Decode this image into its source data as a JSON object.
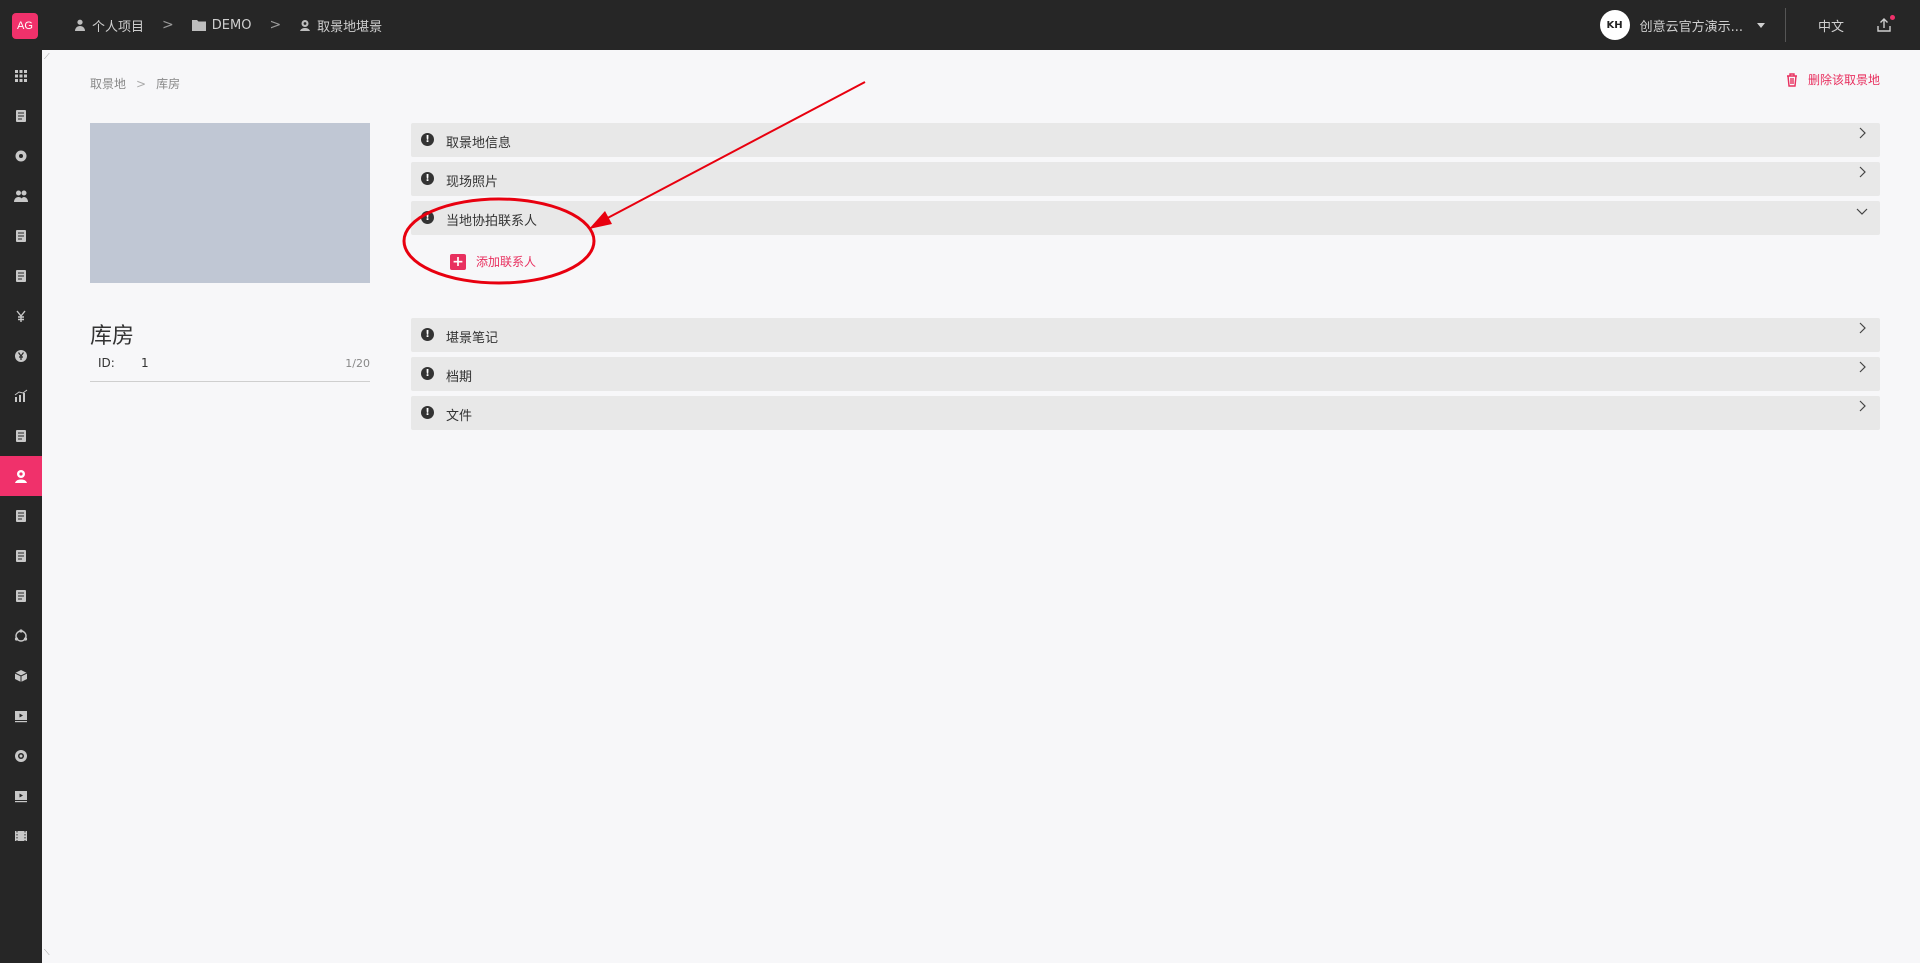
{
  "header": {
    "logo_text": "AG",
    "breadcrumbs": [
      {
        "icon": "user-icon",
        "label": "个人项目"
      },
      {
        "icon": "folder-icon",
        "label": "DEMO"
      },
      {
        "icon": "location-icon",
        "label": "取景地堪景"
      }
    ],
    "avatar_text": "KH",
    "org_name": "创意云官方演示...",
    "language": "中文"
  },
  "sidebar": {
    "items": [
      {
        "icon": "grid-icon"
      },
      {
        "icon": "script-icon"
      },
      {
        "icon": "settings-icon"
      },
      {
        "icon": "people-icon"
      },
      {
        "icon": "database-icon"
      },
      {
        "icon": "schedule-icon"
      },
      {
        "icon": "budget-icon"
      },
      {
        "icon": "yen-icon"
      },
      {
        "icon": "chart-icon"
      },
      {
        "icon": "report-icon"
      },
      {
        "icon": "location-icon",
        "active": true
      },
      {
        "icon": "costume-icon"
      },
      {
        "icon": "makeup-icon"
      },
      {
        "icon": "props-icon"
      },
      {
        "icon": "network-icon"
      },
      {
        "icon": "cube-icon"
      },
      {
        "icon": "video-icon"
      },
      {
        "icon": "disc-icon"
      },
      {
        "icon": "playback-icon"
      },
      {
        "icon": "film-icon"
      }
    ]
  },
  "page": {
    "breadcrumb": [
      "取景地",
      "库房"
    ],
    "delete_label": "删除该取景地",
    "location_title": "库房",
    "id_label": "ID:",
    "id_value": "1",
    "id_count": "1/20"
  },
  "panels": [
    {
      "title": "取景地信息",
      "expanded": false
    },
    {
      "title": "现场照片",
      "expanded": false
    },
    {
      "title": "当地协拍联系人",
      "expanded": true
    },
    {
      "title": "堪景笔记",
      "expanded": false
    },
    {
      "title": "档期",
      "expanded": false
    },
    {
      "title": "文件",
      "expanded": false
    }
  ],
  "add_contact_label": "添加联系人",
  "colors": {
    "accent": "#f0316b",
    "topbar": "#262626",
    "annotation": "#e8000f"
  }
}
